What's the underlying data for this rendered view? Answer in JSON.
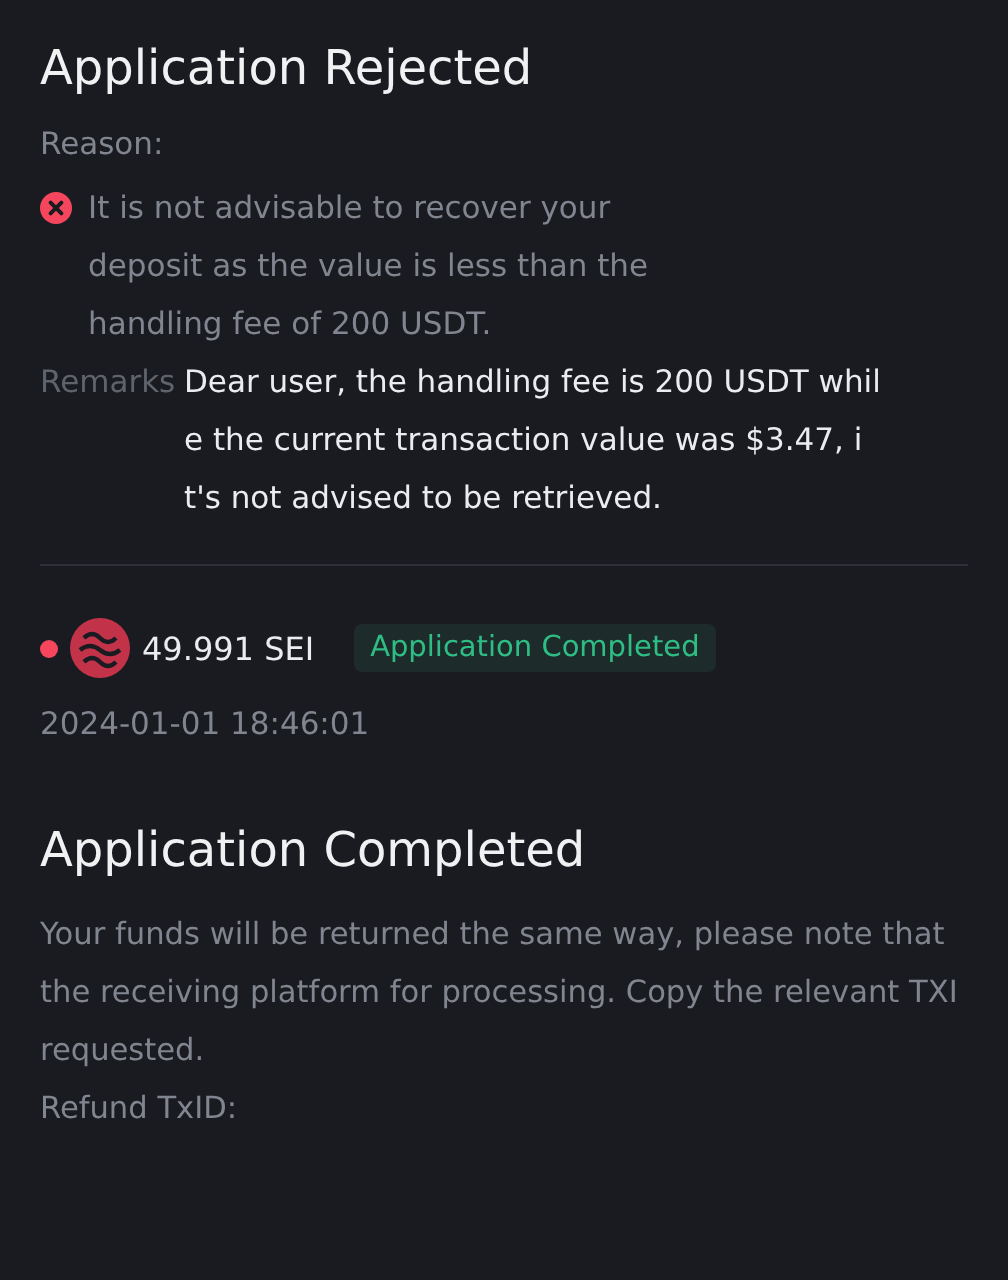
{
  "rejection": {
    "title": "Application Rejected",
    "reason_label": "Reason:",
    "reason_lines": [
      "It is not advisable to recover your",
      "deposit as the value is less than the",
      "handling fee of 200 USDT."
    ],
    "remarks_label": "Remarks",
    "remarks_lines": [
      "Dear user, the handling fee is 200 USDT whil",
      "e the current transaction value was $3.47, i",
      "t's not advised to be retrieved."
    ]
  },
  "record": {
    "unread": true,
    "amount": "49.991 SEI",
    "status": "Application Completed",
    "date": "2024-01-01 18:46:01"
  },
  "completed": {
    "title": "Application Completed",
    "lines": [
      "Your funds will be returned the same way, please note that",
      "the receiving platform for processing. Copy the relevant TXI",
      "requested.",
      "Refund TxID:"
    ]
  }
}
